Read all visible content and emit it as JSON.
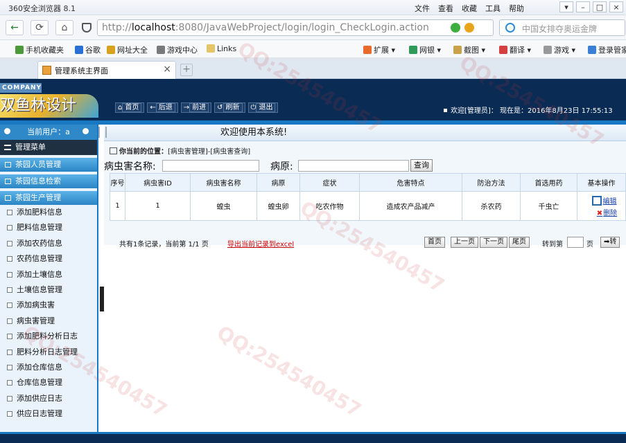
{
  "browser": {
    "app_title": "360安全浏览器 8.1",
    "menu": [
      "文件",
      "查看",
      "收藏",
      "工具",
      "帮助"
    ],
    "address": {
      "scheme": "http://",
      "host": "localhost",
      "rest": ":8080/JavaWebProject/login/login_CheckLogin.action"
    },
    "search_placeholder": "中国女排夺奥运金牌",
    "bookmarks": [
      "手机收藏夹",
      "谷歌",
      "网址大全",
      "游戏中心",
      "Links",
      "扩展",
      "网银",
      "截图",
      "翻译",
      "游戏",
      "登录管家"
    ],
    "tab_title": "管理系统主界面"
  },
  "header": {
    "company": "COMPANY",
    "logo_text": "双鱼林设计",
    "nav": [
      "首页",
      "后退",
      "前进",
      "刷新",
      "退出"
    ],
    "welcome_user": "欢迎[管理员]：  现在是：2016年8月23日  17:55:13"
  },
  "sidebar": {
    "current_user": "当前用户：a",
    "menu_title": "管理菜单",
    "sections": [
      "茶园人员管理",
      "茶园信息检索",
      "茶园生产管理"
    ],
    "items": [
      "添加肥料信息",
      "肥料信息管理",
      "添加农药信息",
      "农药信息管理",
      "添加土壤信息",
      "土壤信息管理",
      "添加病虫害",
      "病虫害管理",
      "添加肥料分析日志",
      "肥料分析日志管理",
      "添加仓库信息",
      "仓库信息管理",
      "添加供应日志",
      "供应日志管理"
    ]
  },
  "main": {
    "welcome": "欢迎使用本系统!",
    "position": "你当前的位置：",
    "position_path": "[病虫害管理]-[病虫害查询]",
    "search": {
      "name_label": "病虫害名称:",
      "source_label": "病原:",
      "button": "查询"
    },
    "table": {
      "headers": [
        "序号",
        "病虫害ID",
        "病虫害名称",
        "病原",
        "症状",
        "危害特点",
        "防治方法",
        "首选用药",
        "基本操作"
      ],
      "rows": [
        [
          "1",
          "1",
          "蝗虫",
          "蝗虫卵",
          "吃农作物",
          "造成农产品减产",
          "杀农药",
          "千虫亡"
        ]
      ],
      "edit_label": "编辑",
      "delete_label": "删除"
    },
    "pager": {
      "info": "共有1条记录，当前第 1/1 页",
      "export": "导出当前记录到excel",
      "buttons": [
        "首页",
        "上一页",
        "下一页",
        "尾页"
      ],
      "goto": "转到第",
      "page_unit": "页",
      "go": "转"
    }
  }
}
